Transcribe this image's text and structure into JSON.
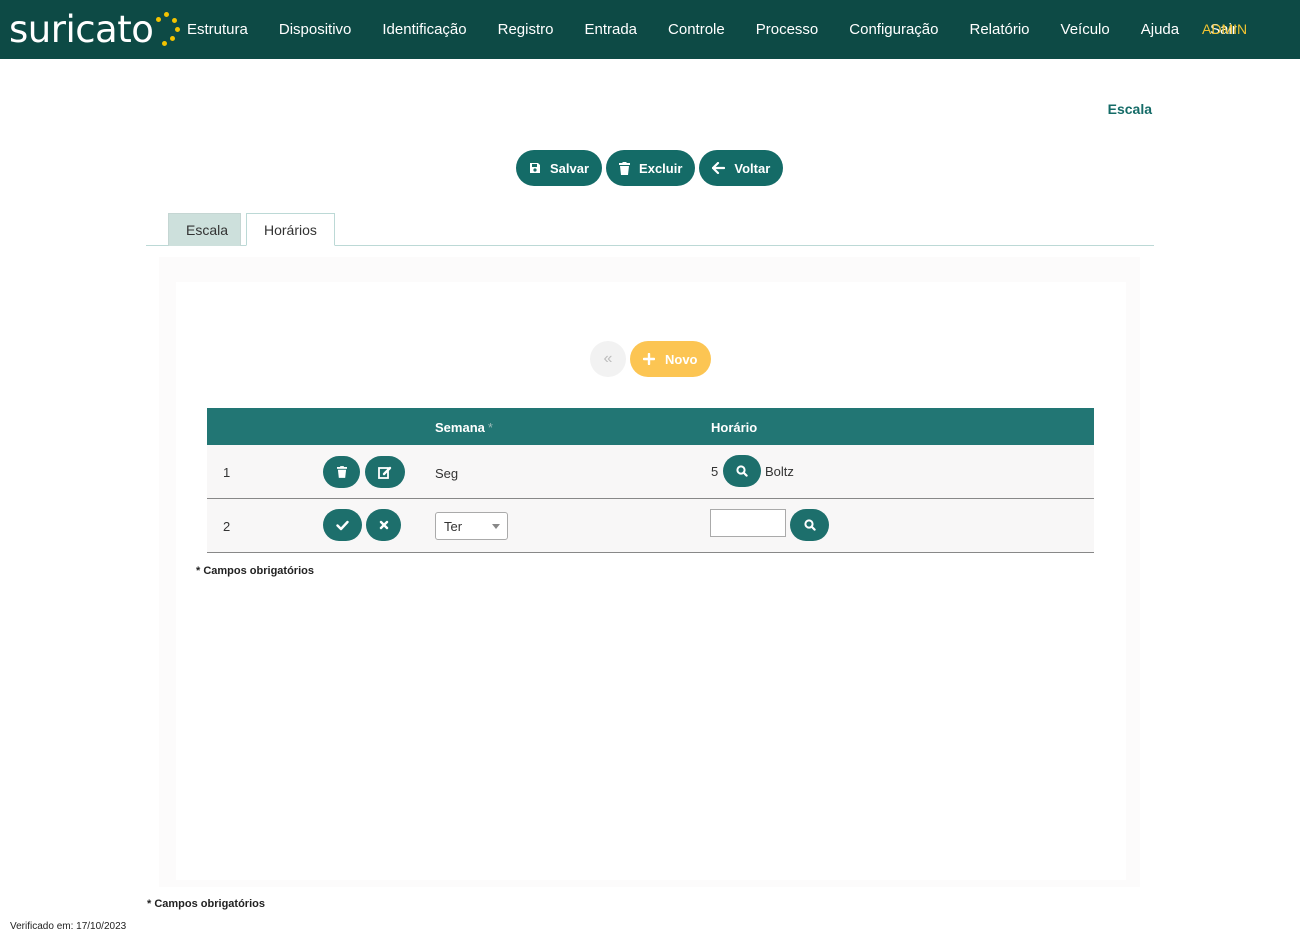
{
  "app": {
    "logo_text": "suricato",
    "admin_label": "ADMIN"
  },
  "nav": {
    "items": [
      "Estrutura",
      "Dispositivo",
      "Identificação",
      "Registro",
      "Entrada",
      "Controle",
      "Processo",
      "Configuração",
      "Relatório",
      "Veículo",
      "Ajuda",
      "Sair"
    ]
  },
  "page": {
    "heading": "Escala"
  },
  "toolbar": {
    "save_label": "Salvar",
    "delete_label": "Excluir",
    "back_label": "Voltar"
  },
  "tabs": [
    {
      "label": "Escala",
      "active": false
    },
    {
      "label": "Horários",
      "active": true
    }
  ],
  "pager": {
    "first_glyph": "«",
    "new_label": "Novo"
  },
  "grid": {
    "columns": {
      "semana": "Semana",
      "semana_required_mark": "*",
      "horario": "Horário"
    },
    "rows": [
      {
        "num": "1",
        "semana": "Seg",
        "horario_code": "5",
        "horario_desc": "Boltz",
        "mode": "view"
      },
      {
        "num": "2",
        "semana": "Ter",
        "horario_code": "",
        "horario_desc": "",
        "mode": "edit"
      }
    ]
  },
  "notes": {
    "required_inner": "* Campos obrigatórios",
    "required_outer": "* Campos obrigatórios"
  },
  "footer": {
    "verified": "Verificado em: 17/10/2023"
  },
  "colors": {
    "topbar": "#0d4a45",
    "primary": "#146b67",
    "grid_header": "#227674",
    "accent": "#fcc553",
    "admin": "#f1c330"
  }
}
